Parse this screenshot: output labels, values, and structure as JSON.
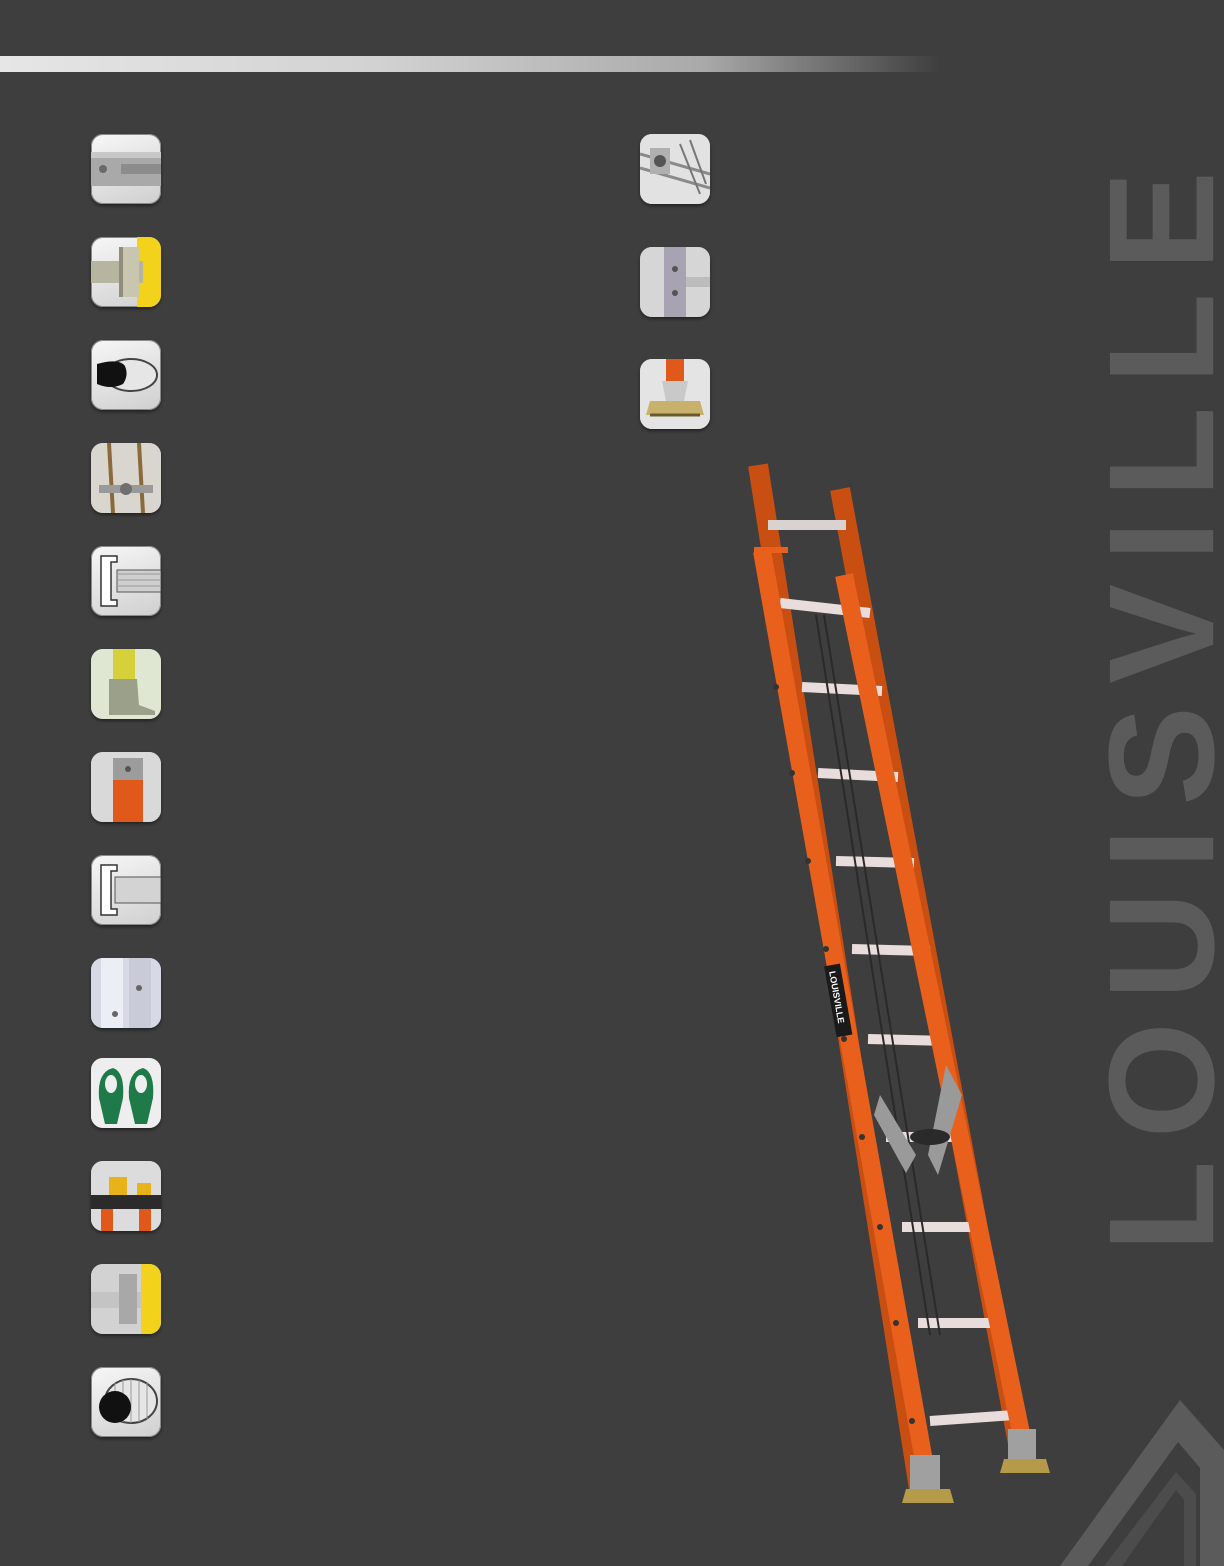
{
  "brand": {
    "wordmark": "LOUISVILLE",
    "ladder_label": "LOUISVILLE"
  },
  "colors": {
    "background": "#3e3e3e",
    "ladder_orange": "#e8601c",
    "brand_gray": "#5b5b5b"
  },
  "feature_icons_left": [
    "rail-slot-icon",
    "rung-rail-joint-icon",
    "d-rung-icon",
    "rope-pulley-icon",
    "i-beam-rail-icon",
    "safety-shoe-icon",
    "rail-end-cap-icon",
    "channel-rail-icon",
    "rung-lock-icon",
    "rail-guide-icon",
    "tool-tray-icon",
    "rail-bracket-icon",
    "round-rung-icon"
  ],
  "feature_icons_right": [
    "pulley-block-icon",
    "rail-lock-icon",
    "swivel-foot-icon"
  ]
}
